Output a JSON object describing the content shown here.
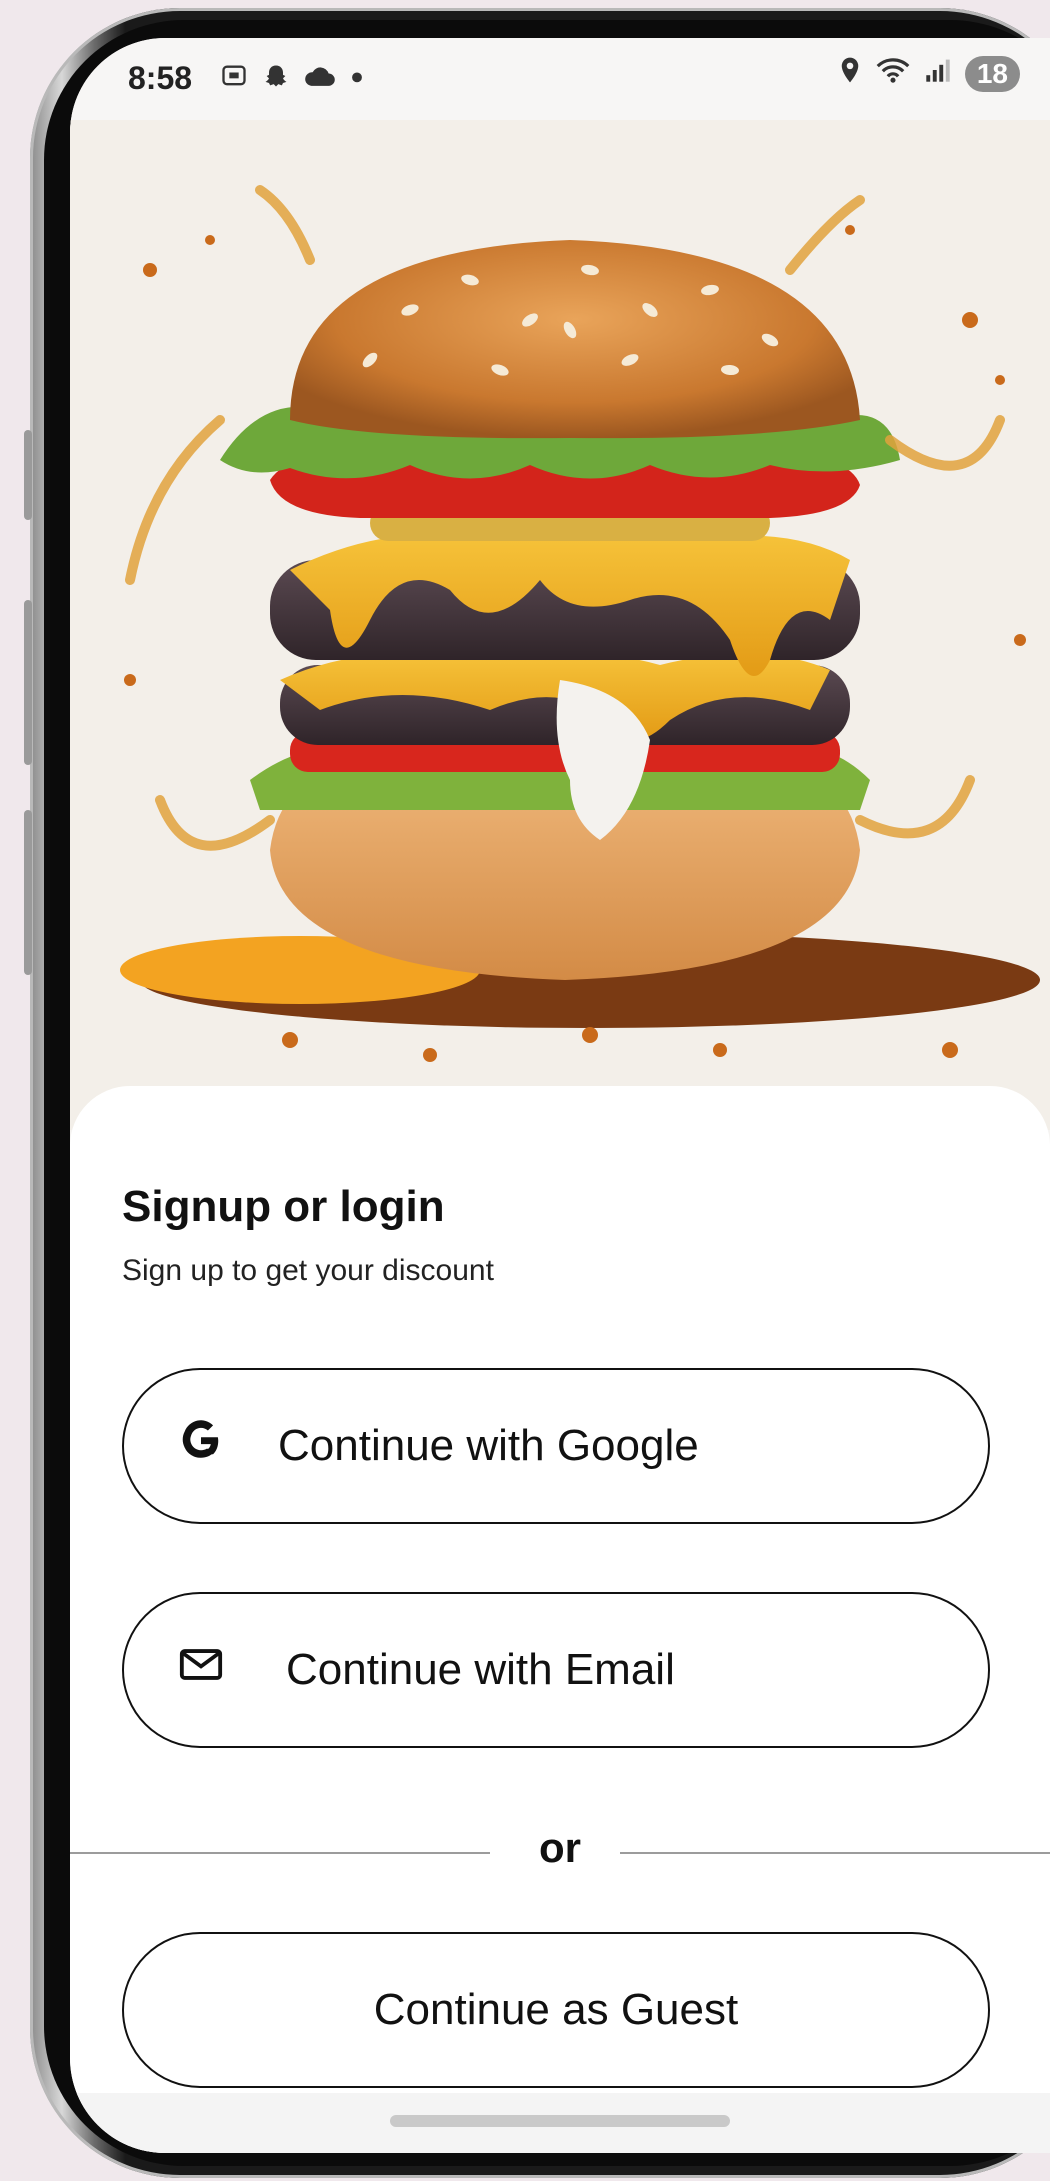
{
  "status_bar": {
    "time": "8:58",
    "left_icons": [
      "screenshot-icon",
      "snapchat-icon",
      "cloud-icon",
      "dot-icon"
    ],
    "right_icons": [
      "location-icon",
      "wifi-icon",
      "signal-icon"
    ],
    "battery": "18"
  },
  "hero": {
    "image": "burger-illustration"
  },
  "auth": {
    "title": "Signup or login",
    "subtitle": "Sign up to get your discount",
    "google_label": "Continue with Google",
    "email_label": "Continue with Email",
    "divider": "or",
    "guest_label": "Continue as Guest"
  },
  "colors": {
    "sheet_bg": "#ffffff",
    "button_border": "#111111",
    "page_bg": "#f0e8ec"
  }
}
